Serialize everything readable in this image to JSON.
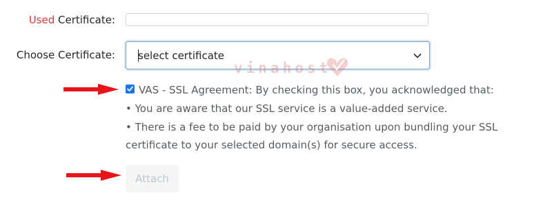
{
  "form": {
    "used_label_highlight": "Used",
    "used_label_rest": " Certificate:",
    "used_value": "",
    "choose_label": "Choose Certificate:",
    "select_value": "select certificate",
    "agreement": {
      "checked": true,
      "line1": "VAS - SSL Agreement: By checking this box, you acknowledged that:",
      "line2": "• You are aware that our SSL service is a value-added service.",
      "line3": "• There is a fee to be paid by your organisation upon bundling your SSL",
      "line4": "certificate to your selected domain(s) for secure access."
    },
    "attach_label": "Attach"
  },
  "watermark": {
    "text": "vinahost"
  },
  "colors": {
    "highlight": "#cc3b3b",
    "checkbox": "#1a73e8",
    "arrow": "#e8141a",
    "button_bg": "#f4f5f6"
  }
}
